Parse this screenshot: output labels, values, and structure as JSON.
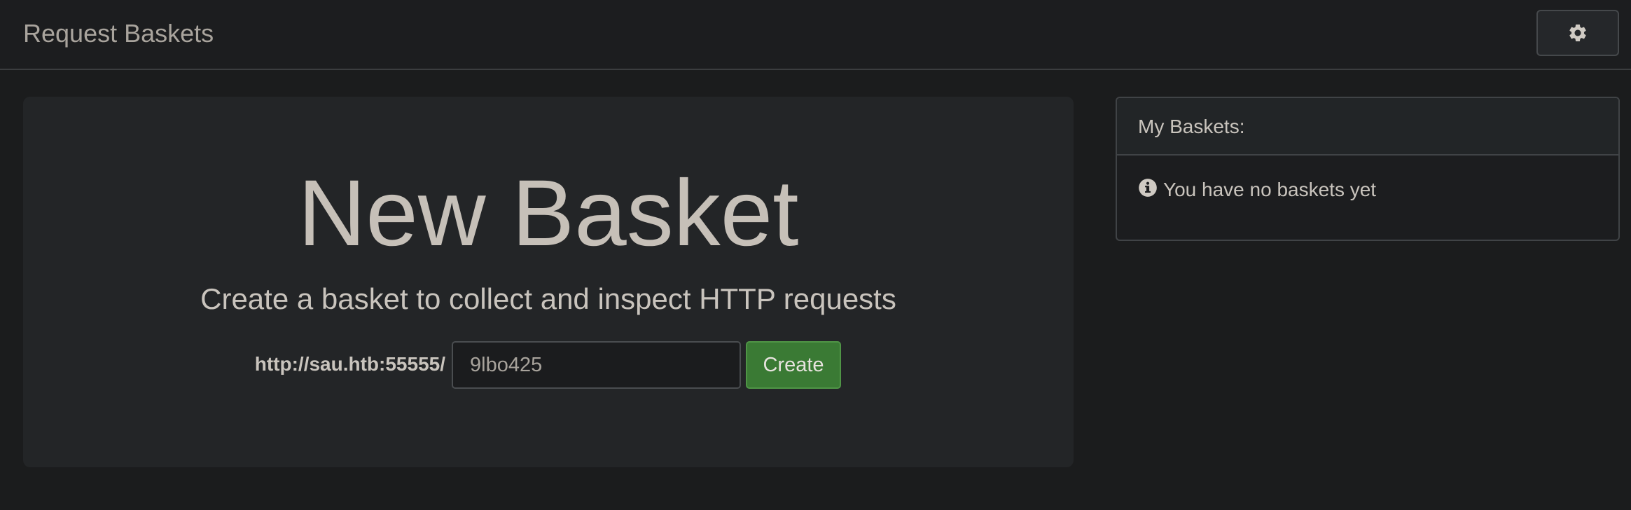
{
  "app": {
    "brand": "Request Baskets"
  },
  "toolbar": {
    "settings_icon": "gear-icon"
  },
  "new_basket": {
    "title": "New Basket",
    "subtitle": "Create a basket to collect and inspect HTTP requests",
    "url_prefix": "http://sau.htb:55555/",
    "basket_name_value": "9lbo425",
    "create_label": "Create"
  },
  "my_baskets": {
    "heading": "My Baskets:",
    "empty_icon": "info-circle-icon",
    "empty_message": "You have no baskets yet"
  },
  "colors": {
    "background": "#1b1c1d",
    "create_button": "#3a7a34"
  }
}
